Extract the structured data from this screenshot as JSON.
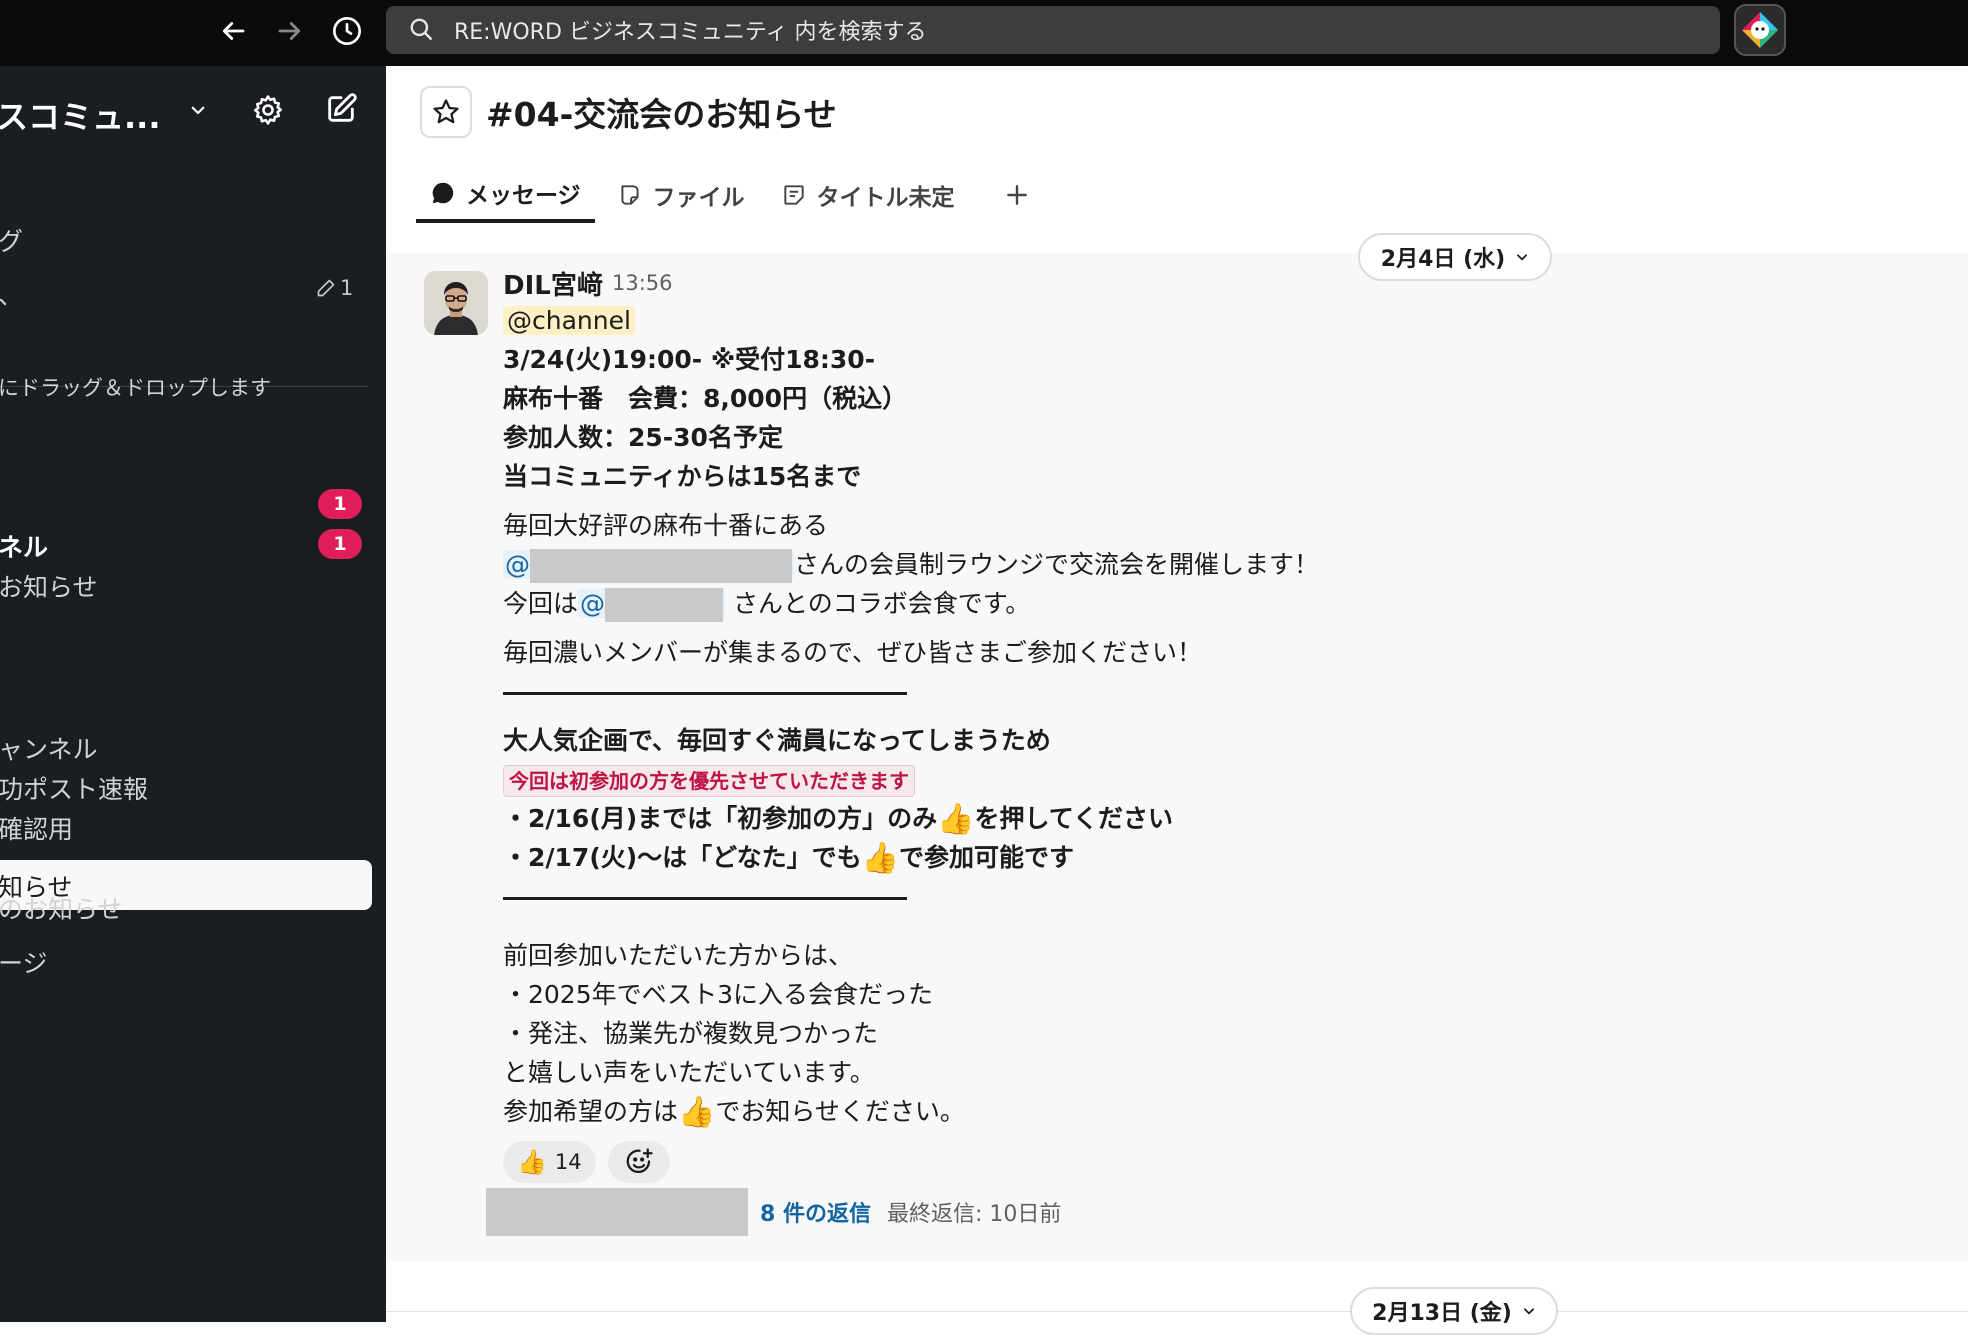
{
  "topbar": {
    "search_placeholder": "RE:WORD ビジネスコミュニティ 内を検索する"
  },
  "sidebar": {
    "workspace_name": "スコミュ...",
    "items": [
      {
        "label": "グ"
      },
      {
        "label": "、"
      },
      {
        "label": "にドラッグ＆ドロップします"
      },
      {
        "label": "ネル"
      },
      {
        "label": "お知らせ"
      },
      {
        "label": "知らせ"
      },
      {
        "label": "ャンネル"
      },
      {
        "label": "功ポスト速報"
      },
      {
        "label": "確認用"
      },
      {
        "label": "のお知らせ"
      },
      {
        "label": "ージ"
      }
    ],
    "draft_count": "1",
    "badges": [
      "1",
      "1"
    ]
  },
  "channel": {
    "name": "#04-交流会のお知らせ",
    "tabs": [
      {
        "label": "メッセージ",
        "icon": "message-icon"
      },
      {
        "label": "ファイル",
        "icon": "file-icon"
      },
      {
        "label": "タイトル未定",
        "icon": "canvas-icon"
      }
    ]
  },
  "dates": {
    "first": "2月4日 (水)",
    "second": "2月13日 (金)"
  },
  "message": {
    "author": "DIL宮﨑",
    "time": "13:56",
    "mention_channel": "@channel",
    "lines": {
      "l1": "3/24(火)19:00-  ※受付18:30-",
      "l2": "麻布十番　会費：8,000円（税込）",
      "l3": "参加人数：25-30名予定",
      "l4": "当コミュニティからは15名まで",
      "l5": "毎回大好評の麻布十番にある",
      "at": "@",
      "l6_tail": "さんの会員制ラウンジで交流会を開催します！",
      "l7_head": "今回は",
      "l7_tail": "さんとのコラボ会食です。",
      "l8": "毎回濃いメンバーが集まるので、ぜひ皆さまご参加ください！",
      "l9": "大人気企画で、毎回すぐ満員になってしまうため",
      "l10_code": "今回は初参加の方を優先させていただきます",
      "l11_head": "・2/16(月)までは「初参加の方」のみ",
      "l11_tail": "を押してください",
      "l12_head": "・2/17(火)〜は「どなた」でも",
      "l12_tail": "で参加可能です",
      "l13": "前回参加いただいた方からは、",
      "l14": "・2025年でベスト3に入る会食だった",
      "l15": "・発注、協業先が複数見つかった",
      "l16": "と嬉しい声をいただいています。",
      "l17_head": "参加希望の方は",
      "l17_tail": "でお知らせください。"
    },
    "thumb_emoji": "👍",
    "reaction": {
      "emoji": "👍",
      "count": "14"
    },
    "thread": {
      "replies": "8 件の返信",
      "last_reply": "最終返信: 10日前"
    }
  }
}
